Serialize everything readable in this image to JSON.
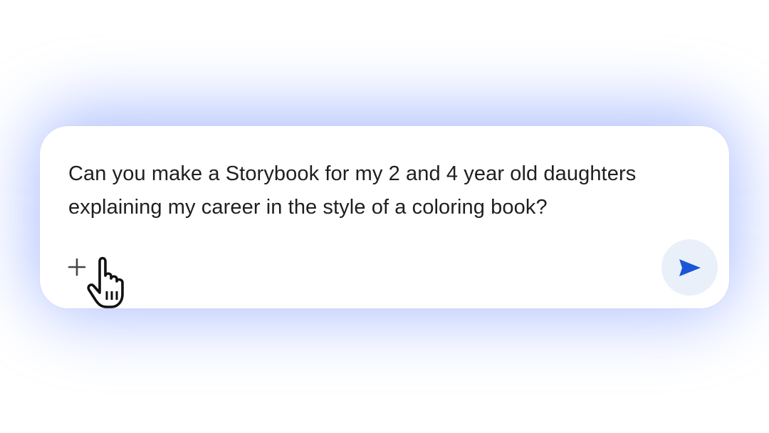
{
  "prompt": {
    "text": "Can you make a Storybook for my 2 and 4 year old daughters explaining my career in the style of a coloring book?"
  },
  "icons": {
    "add": "plus-icon",
    "send": "send-arrow-icon",
    "cursor": "hand-pointer-cursor"
  },
  "colors": {
    "background": "#ffffff",
    "glow": "#8aa6ff",
    "text": "#1f1f1f",
    "send_button_bg": "#eaf0fa",
    "send_arrow": "#1a56d6"
  }
}
